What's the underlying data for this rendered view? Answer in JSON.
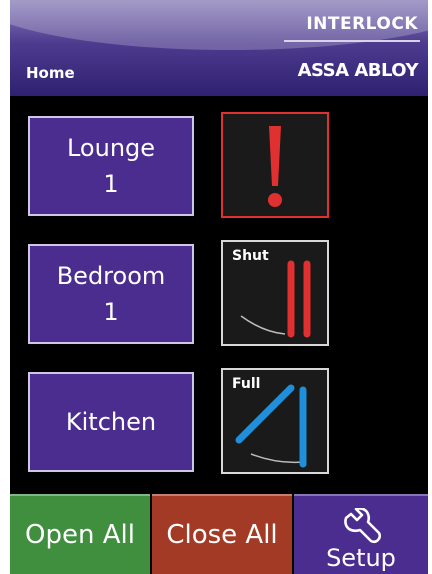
{
  "header": {
    "title": "Home",
    "brand_top": "INTERLOCK",
    "brand_bottom": "ASSA ABLOY"
  },
  "rooms": [
    {
      "name": "Lounge",
      "number": "1",
      "status": "alert",
      "status_label": ""
    },
    {
      "name": "Bedroom",
      "number": "1",
      "status": "shut",
      "status_label": "Shut"
    },
    {
      "name": "Kitchen",
      "number": "",
      "status": "full",
      "status_label": "Full"
    }
  ],
  "actions": {
    "open_all": "Open All",
    "close_all": "Close All",
    "setup": "Setup"
  },
  "icons": {
    "alert": "exclamation-icon",
    "shut": "shutter-shut-icon",
    "full": "shutter-full-open-icon",
    "setup": "wrench-icon"
  },
  "colors": {
    "room_button": "#4b2c8f",
    "open_all": "#3f8f3f",
    "close_all": "#a23a25",
    "alert": "#e03030",
    "shut": "#e03030",
    "full": "#1e8fd8"
  }
}
